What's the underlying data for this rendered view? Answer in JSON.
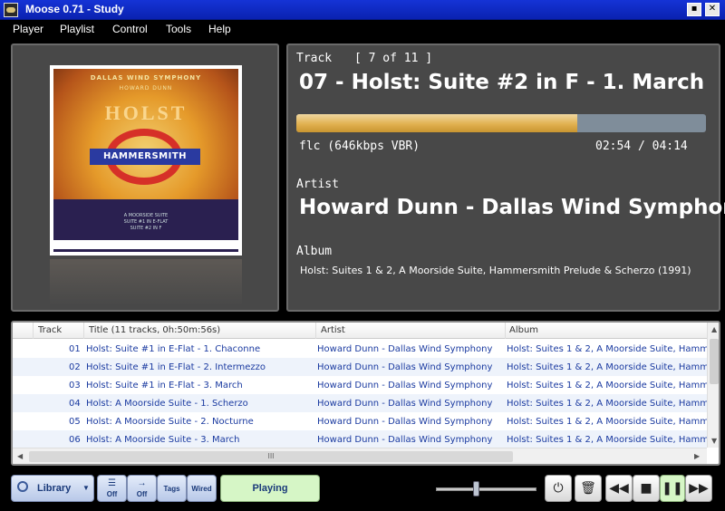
{
  "window": {
    "title": "Moose 0.71 - Study"
  },
  "menu": [
    "Player",
    "Playlist",
    "Control",
    "Tools",
    "Help"
  ],
  "cover": {
    "line1": "DALLAS WIND SYMPHONY",
    "line2": "HOWARD DUNN",
    "composer": "HOLST",
    "sign": "HAMMERSMITH",
    "contents": [
      "A MOORSIDE SUITE",
      "SUITE #1 IN E-FLAT",
      "SUITE #2 IN F"
    ]
  },
  "now_playing": {
    "track_label": "Track",
    "track_position": "[ 7 of 11 ]",
    "title": "07 - Holst: Suite #2 in F - 1. March",
    "progress_fraction": 0.686,
    "format": "flc (646kbps VBR)",
    "time": "02:54 / 04:14",
    "artist_label": "Artist",
    "artist": "Howard Dunn - Dallas Wind Symphony",
    "album_label": "Album",
    "album": "Holst: Suites 1 & 2, A Moorside Suite, Hammersmith Prelude & Scherzo (1991)"
  },
  "tracklist": {
    "columns": [
      "Track",
      "Title (11 tracks,  0h:50m:56s)",
      "Artist",
      "Album"
    ],
    "rows": [
      {
        "track": "01",
        "title": "Holst: Suite #1 in E-Flat - 1. Chaconne",
        "artist": "Howard Dunn - Dallas Wind Symphony",
        "album": "Holst: Suites 1 & 2, A Moorside Suite, Hamm"
      },
      {
        "track": "02",
        "title": "Holst: Suite #1 in E-Flat - 2. Intermezzo",
        "artist": "Howard Dunn - Dallas Wind Symphony",
        "album": "Holst: Suites 1 & 2, A Moorside Suite, Hamm"
      },
      {
        "track": "03",
        "title": "Holst: Suite #1 in E-Flat - 3. March",
        "artist": "Howard Dunn - Dallas Wind Symphony",
        "album": "Holst: Suites 1 & 2, A Moorside Suite, Hamm"
      },
      {
        "track": "04",
        "title": "Holst: A Moorside Suite - 1. Scherzo",
        "artist": "Howard Dunn - Dallas Wind Symphony",
        "album": "Holst: Suites 1 & 2, A Moorside Suite, Hamm"
      },
      {
        "track": "05",
        "title": "Holst: A Moorside Suite - 2. Nocturne",
        "artist": "Howard Dunn - Dallas Wind Symphony",
        "album": "Holst: Suites 1 & 2, A Moorside Suite, Hamm"
      },
      {
        "track": "06",
        "title": "Holst: A Moorside Suite - 3. March",
        "artist": "Howard Dunn - Dallas Wind Symphony",
        "album": "Holst: Suites 1 & 2, A Moorside Suite, Hamm"
      }
    ],
    "hscroll_grip": "III"
  },
  "controls": {
    "library_label": "Library",
    "repeat": {
      "icon": "repeat-icon",
      "state": "Off"
    },
    "shuffle": {
      "icon": "shuffle-icon",
      "state": "Off"
    },
    "tags_label": "Tags",
    "wired_label": "Wired",
    "playing_label": "Playing",
    "volume_fraction": 0.4,
    "icons": [
      "power-icon",
      "trash-icon",
      "rewind-icon",
      "stop-icon",
      "pause-icon",
      "fast-forward-icon"
    ]
  },
  "colors": {
    "titlebar": "#0a22b0",
    "progress": "#e1b150",
    "playing": "#d6f6c6",
    "row_text": "#1a3aa0"
  }
}
